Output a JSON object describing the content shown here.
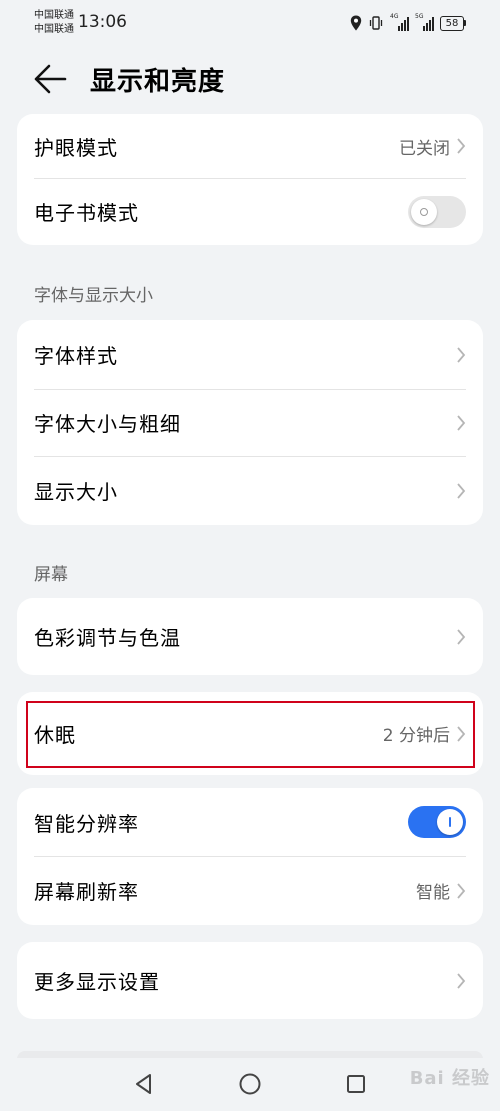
{
  "status_bar": {
    "carrier_1": "中国联通",
    "carrier_2": "中国联通",
    "time": "13:06",
    "signal_1_gen": "4G",
    "signal_2_gen": "5G",
    "battery": "58"
  },
  "header": {
    "title": "显示和亮度"
  },
  "eye_card": {
    "eye_comfort": {
      "label": "护眼模式",
      "value": "已关闭"
    },
    "ebook_mode": {
      "label": "电子书模式",
      "enabled": false
    }
  },
  "font_section": {
    "heading": "字体与显示大小",
    "items": [
      {
        "label": "字体样式"
      },
      {
        "label": "字体大小与粗细"
      },
      {
        "label": "显示大小"
      }
    ]
  },
  "screen_section": {
    "heading": "屏幕",
    "color": {
      "label": "色彩调节与色温"
    },
    "sleep": {
      "label": "休眠",
      "value": "2 分钟后"
    },
    "smart_resolution": {
      "label": "智能分辨率",
      "enabled": true
    },
    "refresh_rate": {
      "label": "屏幕刷新率",
      "value": "智能"
    },
    "more": {
      "label": "更多显示设置"
    }
  },
  "watermark": "Bai 经验",
  "colors": {
    "background": "#f1f3f5",
    "accent": "#2a72f2",
    "highlight": "#d0021b"
  }
}
